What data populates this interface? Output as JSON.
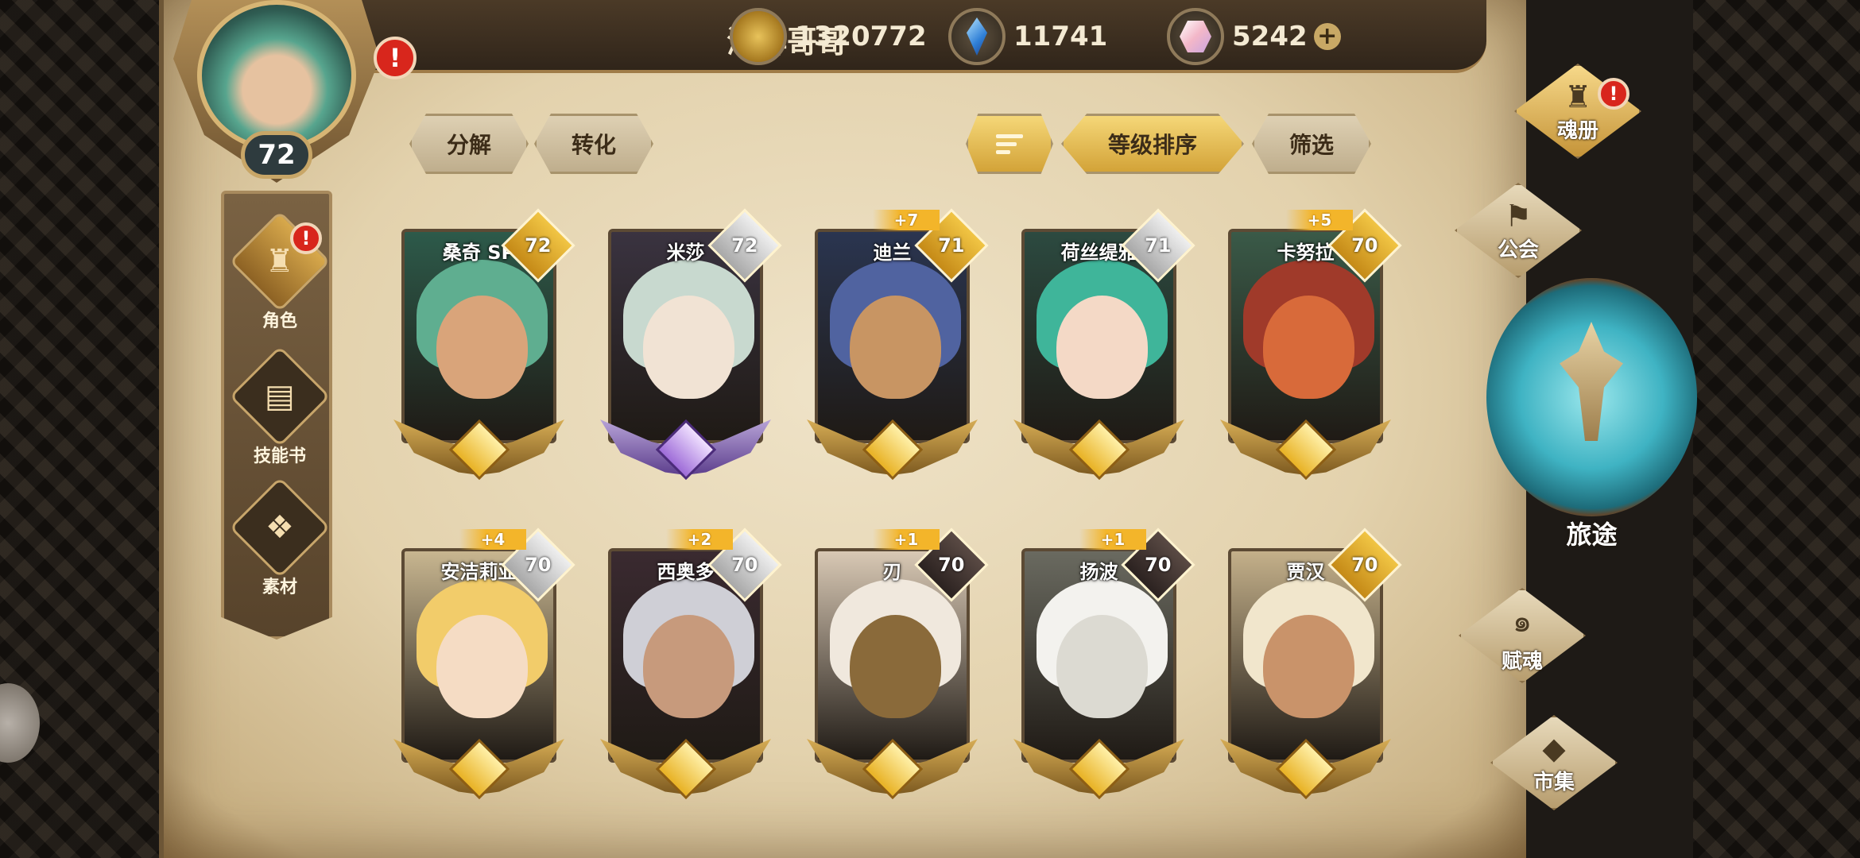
{
  "player": {
    "name": "海鲜哥哥",
    "level": "72",
    "alert": "!"
  },
  "currencies": [
    {
      "icon": "gold-coin-icon",
      "value": "1320772"
    },
    {
      "icon": "blue-crystal-icon",
      "value": "11741"
    },
    {
      "icon": "pink-gem-icon",
      "value": "5242",
      "plus": "+"
    }
  ],
  "left_nav": [
    {
      "label": "角色",
      "icon": "helmet-icon",
      "alert": "!",
      "active": true
    },
    {
      "label": "技能书",
      "icon": "skill-book-icon"
    },
    {
      "label": "素材",
      "icon": "material-icon"
    }
  ],
  "toolbar": {
    "decompose": "分解",
    "convert": "转化",
    "sort_by_level": "等级排序",
    "filter": "筛选"
  },
  "heroes": [
    {
      "name": "桑奇 SP",
      "level": "72",
      "plus": "",
      "tag": "gold",
      "colors": [
        "#2d5a4a",
        "#5fae90",
        "#d9a47a"
      ]
    },
    {
      "name": "米莎",
      "level": "72",
      "plus": "",
      "tag": "silver",
      "colors": [
        "#3a3340",
        "#c8d9cf",
        "#f1e3d4"
      ],
      "purple": true
    },
    {
      "name": "迪兰",
      "level": "71",
      "plus": "+7",
      "tag": "gold",
      "colors": [
        "#2a3550",
        "#5063a0",
        "#c89563"
      ]
    },
    {
      "name": "荷丝缇雅",
      "level": "71",
      "plus": "",
      "tag": "silver",
      "colors": [
        "#2c4a40",
        "#3fb59a",
        "#f4d9c6"
      ]
    },
    {
      "name": "卡努拉",
      "level": "70",
      "plus": "+5",
      "tag": "gold",
      "colors": [
        "#3a5a48",
        "#a03a2a",
        "#d86a3a"
      ]
    },
    {
      "name": "安洁莉亚",
      "level": "70",
      "plus": "+4",
      "tag": "silver",
      "colors": [
        "#c8b690",
        "#f2cc6a",
        "#f5dcc4"
      ]
    },
    {
      "name": "西奥多",
      "level": "70",
      "plus": "+2",
      "tag": "silver",
      "colors": [
        "#3a2a30",
        "#cfcfd6",
        "#c79a7c"
      ]
    },
    {
      "name": "刃",
      "level": "70",
      "plus": "+1",
      "tag": "dark",
      "colors": [
        "#d8c8b4",
        "#f0e8dd",
        "#8a6a3a"
      ]
    },
    {
      "name": "扬波",
      "level": "70",
      "plus": "+1",
      "tag": "dark",
      "colors": [
        "#6a6a60",
        "#f3f2ee",
        "#dcdad2"
      ]
    },
    {
      "name": "贾汉",
      "level": "70",
      "plus": "",
      "tag": "gold",
      "colors": [
        "#c4b08a",
        "#f1e6cc",
        "#c9936a"
      ]
    }
  ],
  "right_menu": {
    "soul_book": "魂册",
    "guild": "公会",
    "journey": "旅途",
    "soul_grant": "赋魂",
    "market": "市集",
    "alert": "!"
  }
}
